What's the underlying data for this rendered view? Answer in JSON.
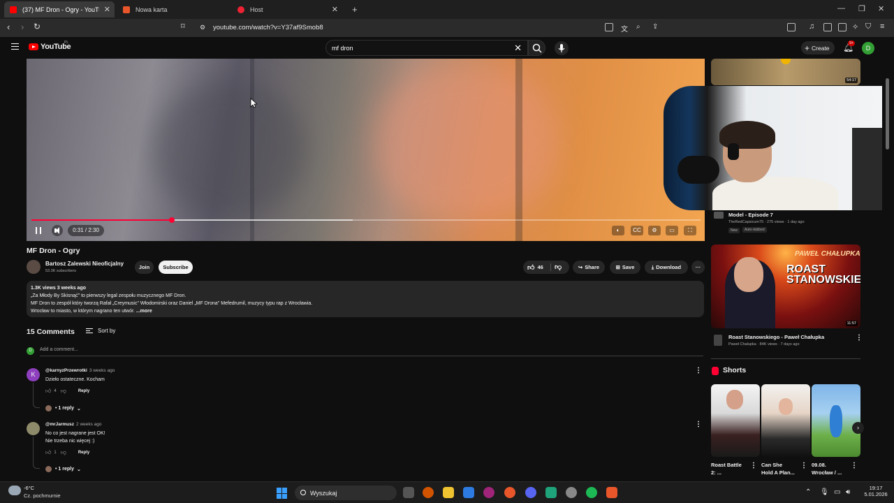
{
  "browser": {
    "tabs": [
      {
        "label": "(37) MF Dron - Ogry - YouTube",
        "active": true,
        "icon": "youtube-icon"
      },
      {
        "label": "Nowa karta",
        "active": false,
        "icon": "brave-icon"
      },
      {
        "label": "Host",
        "active": false,
        "icon": "recording-icon"
      }
    ],
    "new_tab": "+",
    "url": "youtube.com/watch?v=Y37af9Smob8"
  },
  "yt_header": {
    "logo_text": "YouTube",
    "logo_region": "PL",
    "search_value": "mf dron",
    "create_label": "Create",
    "notifications": "9+",
    "avatar_letter": "D"
  },
  "player": {
    "time": "0:31 / 2:30",
    "progress_fraction": 0.207
  },
  "video": {
    "title": "MF Dron - Ogry",
    "channel": "Bartosz Zalewski Nieoficjalny",
    "subscribers": "53.3K subscribers",
    "join_label": "Join",
    "subscribe_label": "Subscribe",
    "likes": "46",
    "share_label": "Share",
    "save_label": "Save",
    "download_label": "Download",
    "more_label": "···"
  },
  "description": {
    "stats": "1.3K views  3 weeks ago",
    "line1": "„Za Młody By Skisnąć\" to pierwszy legal zespołu muzycznego MF Dron.",
    "line2": "MF Dron to zespół który tworzą Rafał „Creymusic\" Włodomirski oraz Daniel „MF Drona\" Mefedrumil, muzycy typu rap z Wrocławia.",
    "line3": "Wrocław to miasto, w którym nagrano ten utwór.",
    "more": "...more"
  },
  "comments": {
    "count_label": "15 Comments",
    "sort_label": "Sort by",
    "add_placeholder": "Add a comment...",
    "my_avatar": "D",
    "reply_label": "Reply",
    "items": [
      {
        "avatar": "K",
        "author": "@karnyzPrzewrotki",
        "ago": "3 weeks ago",
        "text1": "Dzieło ostateczne. Kocham",
        "text2": "",
        "likes": "4",
        "replies": "1 reply"
      },
      {
        "avatar": "",
        "author": "@mrJarmusz",
        "ago": "2 weeks ago",
        "text1": "No co jest nagrane jest OK!",
        "text2": "Nie trzeba nic więcej :)",
        "likes": "1",
        "replies": "1 reply"
      }
    ]
  },
  "related": {
    "top_duration": "54:17",
    "model_title": "Model - Episode 7",
    "model_meta": "TheRedCapsicum75 · 275 views · 1 day ago",
    "model_badge_new": "New",
    "model_badge_dub": "Auto-dubbed",
    "roast_thumb_line1": "PAWEŁ CHAŁUPKA",
    "roast_thumb_line2": "ROAST STANOWSKIEGO",
    "roast_duration": "11:57",
    "roast_title": "Roast Stanowskiego - Paweł Chałupka",
    "roast_meta": "Paweł Chałupka · 84K views · 7 days ago"
  },
  "shorts": {
    "section_title": "Shorts",
    "items": [
      {
        "title1": "Roast Battle",
        "title2": "2: ..."
      },
      {
        "title1": "Can She",
        "title2": "Hold A Plan..."
      },
      {
        "title1": "09.08.",
        "title2": "Wrocław / ..."
      }
    ]
  },
  "taskbar": {
    "temp": "-6°C",
    "condition": "Cz. pochmurnie",
    "search_label": "Wyszukaj",
    "time": "19:17",
    "date": "5.01.2026"
  },
  "colors": {
    "accent": "#ff0033",
    "background": "#0f0f0f"
  }
}
